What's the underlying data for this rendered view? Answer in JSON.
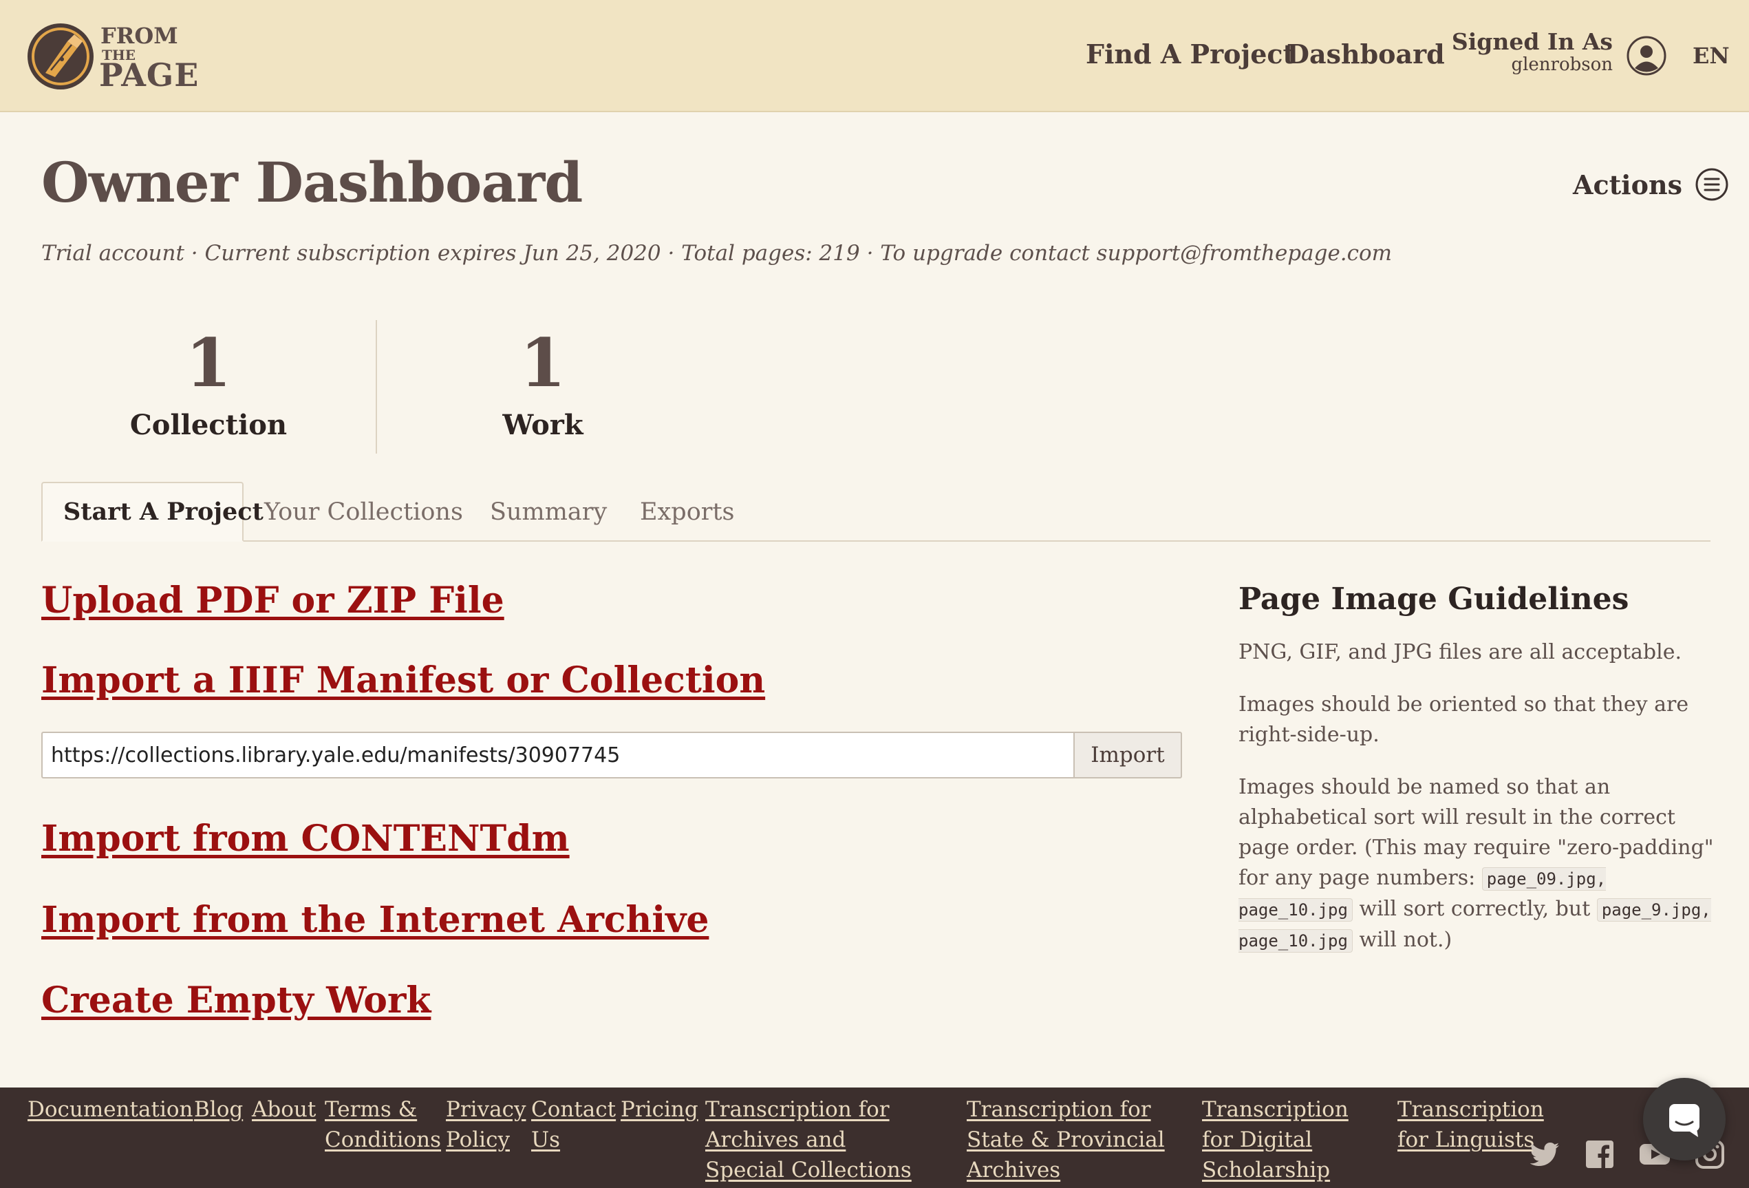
{
  "header": {
    "logo": {
      "from": "FROM",
      "the": "THE",
      "page": "PAGE"
    },
    "nav": {
      "find_project": "Find A Project",
      "dashboard": "Dashboard"
    },
    "signed_in": {
      "label": "Signed In As",
      "username": "glenrobson"
    },
    "language": "EN"
  },
  "page": {
    "title": "Owner Dashboard",
    "actions_label": "Actions",
    "subscription_line": "Trial account · Current subscription expires Jun 25, 2020 · Total pages: 219 · To upgrade contact support@fromthepage.com"
  },
  "stats": [
    {
      "value": "1",
      "label": "Collection"
    },
    {
      "value": "1",
      "label": "Work"
    }
  ],
  "tabs": [
    {
      "label": "Start A Project",
      "active": true
    },
    {
      "label": "Your Collections",
      "active": false
    },
    {
      "label": "Summary",
      "active": false
    },
    {
      "label": "Exports",
      "active": false
    }
  ],
  "start_project": {
    "upload_link": "Upload PDF or ZIP File",
    "iiif_link": "Import a IIIF Manifest or Collection",
    "iiif_input_value": "https://collections.library.yale.edu/manifests/30907745",
    "import_button": "Import",
    "contentdm_link": "Import from CONTENTdm",
    "archive_link": "Import from the Internet Archive",
    "empty_work_link": "Create Empty Work"
  },
  "guidelines": {
    "title": "Page Image Guidelines",
    "p1": "PNG, GIF, and JPG files are all acceptable.",
    "p2": "Images should be oriented so that they are right-side-up.",
    "p3_a": "Images should be named so that an alphabetical sort will result in the correct page order. (This may require \"zero-padding\" for any page numbers:",
    "p3_code1": "page_09.jpg, page_10.jpg",
    "p3_b": "will sort correctly, but",
    "p3_code2": "page_9.jpg, page_10.jpg",
    "p3_c": "will not.)"
  },
  "footer": {
    "links": {
      "documentation": "Documentation",
      "blog": "Blog",
      "about": "About",
      "terms": "Terms & Conditions",
      "privacy": "Privacy Policy",
      "contact": "Contact Us",
      "pricing": "Pricing",
      "archives": "Transcription for Archives and Special Collections",
      "state": "Transcription for State & Provincial Archives",
      "digital": "Transcription for Digital Scholarship",
      "linguists": "Transcription for Linguists"
    },
    "social_icons": [
      "twitter-icon",
      "facebook-icon",
      "youtube-icon",
      "instagram-icon"
    ]
  },
  "colors": {
    "header_bg": "#f1e4c3",
    "page_bg": "#f9f5ec",
    "link_red": "#9b1010",
    "footer_bg": "#3c2f2d",
    "footer_link": "#e8d9bf"
  }
}
